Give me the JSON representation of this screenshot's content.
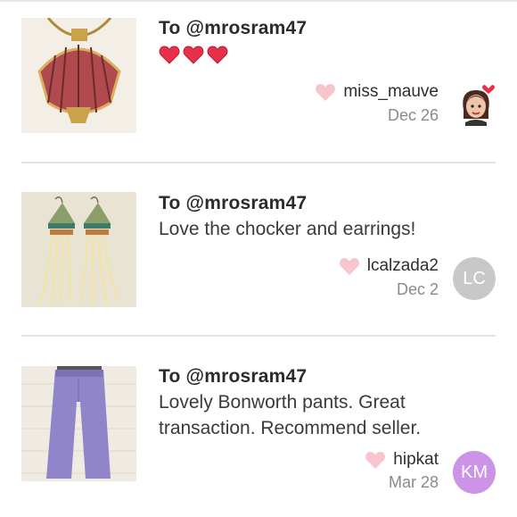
{
  "comments": [
    {
      "to": "To @mrosram47",
      "message": "",
      "hearts_count": 3,
      "username": "miss_mauve",
      "date": "Dec 26",
      "avatar_initials": "",
      "avatar_color": "",
      "thumb": "shell-pendant-necklace"
    },
    {
      "to": "To @mrosram47",
      "message": "Love the chocker and earrings!",
      "username": "lcalzada2",
      "date": "Dec 2",
      "avatar_initials": "LC",
      "avatar_color": "#c8c8c8",
      "thumb": "beaded-feather-earrings"
    },
    {
      "to": "To @mrosram47",
      "message": "Lovely Bonworth pants. Great transaction. Recommend seller.",
      "username": "hipkat",
      "date": "Mar 28",
      "avatar_initials": "KM",
      "avatar_color": "#cc94e6",
      "thumb": "purple-pants"
    }
  ],
  "colors": {
    "heart_red": "#e8304a",
    "like_heart": "#f7c6cc",
    "divider": "#e2e2e2",
    "date_gray": "#8a8a8a"
  }
}
